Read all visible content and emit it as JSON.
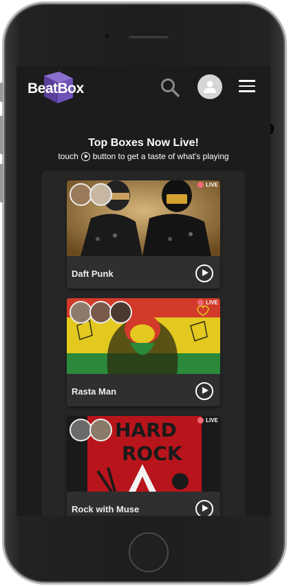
{
  "app": {
    "name": "BeatBox",
    "brand_color": "#6a4fb0"
  },
  "header": {
    "search_icon": "search-icon",
    "account_icon": "account-icon",
    "menu_icon": "hamburger-menu-icon"
  },
  "intro": {
    "title": "Top Boxes Now Live!",
    "subtitle_before": "touch",
    "subtitle_after": "button to get a taste of what's playing"
  },
  "boxes": [
    {
      "title": "Daft Punk",
      "badge": "LIVE",
      "listener_count": 2,
      "theme": "#7b5a2a"
    },
    {
      "title": "Rasta Man",
      "badge": "LIVE",
      "listener_count": 3,
      "theme": "#d9c21e"
    },
    {
      "title": "Rock with Muse",
      "badge": "LIVE",
      "listener_count": 2,
      "theme": "#c0141c"
    }
  ],
  "colors": {
    "live_dot": "#f06a7a",
    "screen_bg": "#1c1c1c",
    "card_bg": "#2f2f2f"
  }
}
